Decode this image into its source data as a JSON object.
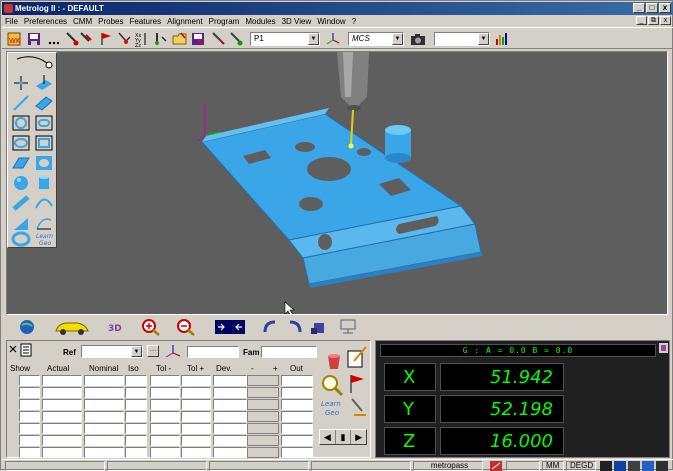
{
  "window": {
    "title": "Metrolog II : - DEFAULT",
    "controls": [
      "_",
      "□",
      "x"
    ],
    "mdi_controls": [
      "_",
      "⧉",
      "x"
    ]
  },
  "menu": [
    "File",
    "Preferences",
    "CMM",
    "Probes",
    "Features",
    "Alignment",
    "Program",
    "Modules",
    "3D View",
    "Window",
    "?"
  ],
  "toolbar": {
    "program_combo": "P1",
    "coord_combo": "MCS",
    "empty_combo": ""
  },
  "tolerance_panel": {
    "ref_label": "Ref",
    "fam_label": "Fam",
    "columns": [
      "Show",
      "Actual",
      "Nominal",
      "Iso",
      "Tol -",
      "Tol +",
      "Dev.",
      "-",
      "+",
      "Out"
    ],
    "row_count": 7
  },
  "readout": {
    "header": "G : A = 0.0 B = 0.0",
    "axes": [
      {
        "label": "X",
        "value": "51.942"
      },
      {
        "label": "Y",
        "value": "52.198"
      },
      {
        "label": "Z",
        "value": "16.000"
      }
    ]
  },
  "statusbar": {
    "machine": "metropass",
    "units": "MM",
    "angle": "DEGD"
  },
  "colors": {
    "part": "#3aa6e8",
    "viewport": "#5e5e5e",
    "readout_text": "#00ff00"
  }
}
